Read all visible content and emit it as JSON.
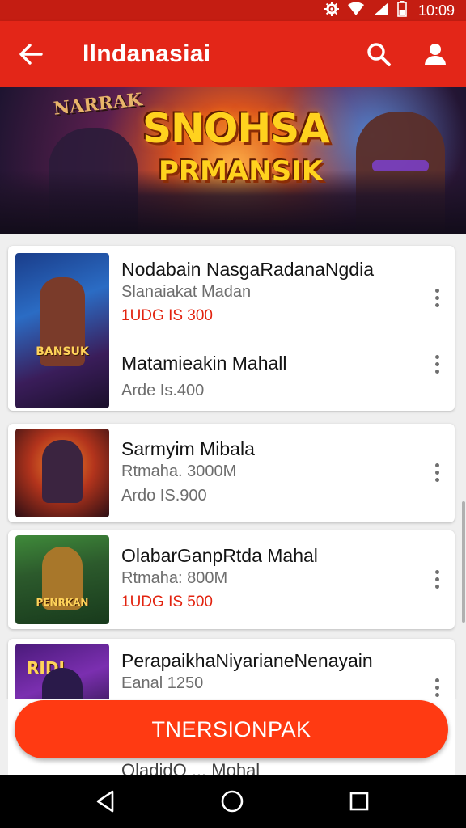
{
  "status_bar": {
    "time": "10:09",
    "icons": [
      "gear-icon",
      "wifi-icon",
      "signal-icon",
      "battery-icon"
    ]
  },
  "app_bar": {
    "title": "Ilndanasiai",
    "icons": [
      "back-arrow-icon",
      "search-icon",
      "account-icon"
    ]
  },
  "banner": {
    "small_text": "NARRAK",
    "title_line1": "SNOHSA",
    "title_line2": "PRMANSIK"
  },
  "items": [
    {
      "title": "Nodabain NasgaRadanaNgdia",
      "subtitle": "Slanaiakat Madan",
      "price": "1UDG IS 300",
      "thumb_label": "BANSUK"
    },
    {
      "title": "Matamieakin Mahall",
      "subtitle": "Arde Is.400"
    },
    {
      "title": "Sarmyim Mibala",
      "subtitle": "Rtmaha. 3000M",
      "subtitle2": "Ardo IS.900",
      "thumb_label": ""
    },
    {
      "title": "OlabarGanpRtda Mahal",
      "subtitle": "Rtmaha: 800M",
      "price": "1UDG IS 500",
      "thumb_label": "PENRKAN"
    },
    {
      "title": "PerapaikhaNiyarianeNenayain",
      "subtitle": "Eanal 1250",
      "thumb_label": "RIDI"
    }
  ],
  "bottom_peek": "OladidO ... Mohal",
  "action_button": {
    "label": "TNERSIONPAK"
  },
  "nav": [
    "back-triangle-icon",
    "home-circle-icon",
    "recents-square-icon"
  ],
  "colors": {
    "app_bar": "#e32618",
    "status_bar": "#c41d12",
    "accent": "#ff3a12",
    "price": "#e2230f"
  }
}
